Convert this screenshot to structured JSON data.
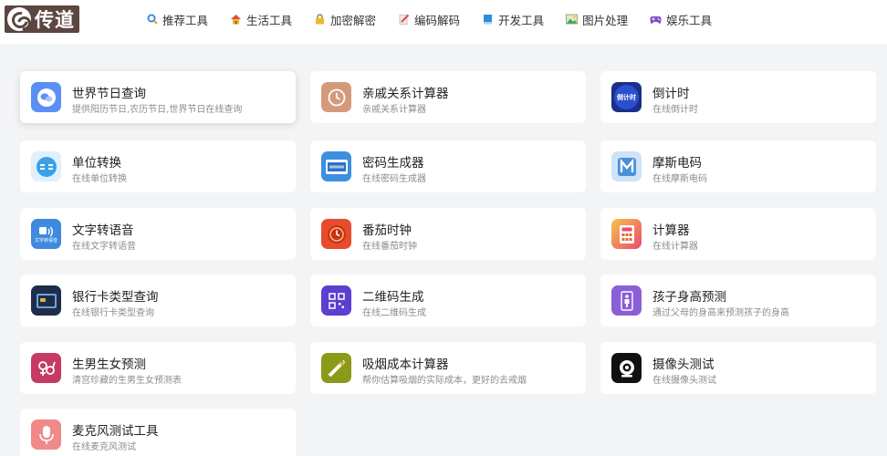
{
  "header": {
    "logo_text": "传道",
    "nav": [
      {
        "label": "推荐工具",
        "icon": "search-icon",
        "color": "#2f80ed"
      },
      {
        "label": "生活工具",
        "icon": "home-icon",
        "color": "#e06b2b"
      },
      {
        "label": "加密解密",
        "icon": "lock-icon",
        "color": "#e0a21e"
      },
      {
        "label": "编码解码",
        "icon": "edit-icon",
        "color": "#d94a6a"
      },
      {
        "label": "开发工具",
        "icon": "book-icon",
        "color": "#2f8ed9"
      },
      {
        "label": "图片处理",
        "icon": "image-icon",
        "color": "#3aa65a"
      },
      {
        "label": "娱乐工具",
        "icon": "gamepad-icon",
        "color": "#7d4fc9"
      }
    ]
  },
  "cards": [
    {
      "title": "世界节日查询",
      "desc": "提供阳历节日,农历节日,世界节日在线查询",
      "icon": "speech-bubble-icon",
      "color": "#5a8ff5"
    },
    {
      "title": "亲戚关系计算器",
      "desc": "亲戚关系计算器",
      "icon": "clock-icon",
      "color": "#d59a7c"
    },
    {
      "title": "倒计时",
      "desc": "在线倒计时",
      "icon": "countdown-icon",
      "icon_text": "倒计时",
      "color": "#1c2f8a"
    },
    {
      "title": "单位转换",
      "desc": "在线单位转换",
      "icon": "unit-convert-icon",
      "color": "#3aa0e8"
    },
    {
      "title": "密码生成器",
      "desc": "在线密码生成器",
      "icon": "password-icon",
      "color": "#3d8fe0"
    },
    {
      "title": "摩斯电码",
      "desc": "在线摩斯电码",
      "icon": "morse-icon",
      "color": "#4a8fd8"
    },
    {
      "title": "文字转语音",
      "desc": "在线文字转语音",
      "icon": "text-to-speech-icon",
      "icon_text": "文字转语音",
      "color": "#3f8ae0"
    },
    {
      "title": "番茄时钟",
      "desc": "在线番茄时钟",
      "icon": "tomato-clock-icon",
      "color": "#e84c2e"
    },
    {
      "title": "计算器",
      "desc": "在线计算器",
      "icon": "calculator-icon",
      "color": "#e94b6e"
    },
    {
      "title": "银行卡类型查询",
      "desc": "在线银行卡类型查询",
      "icon": "bank-card-icon",
      "color": "#1e2d4a"
    },
    {
      "title": "二维码生成",
      "desc": "在线二维码生成",
      "icon": "qrcode-icon",
      "color": "#5a3fd0"
    },
    {
      "title": "孩子身高预测",
      "desc": "通过父母的身高来预测孩子的身高",
      "icon": "height-icon",
      "color": "#8a5fd8"
    },
    {
      "title": "生男生女预测",
      "desc": "清宫珍藏的生男生女预测表",
      "icon": "gender-icon",
      "color": "#c73a66"
    },
    {
      "title": "吸烟成本计算器",
      "desc": "帮你估算吸烟的实际成本，更好的去戒烟",
      "icon": "cigarette-icon",
      "color": "#8a9a1a"
    },
    {
      "title": "摄像头测试",
      "desc": "在线摄像头测试",
      "icon": "camera-icon",
      "color": "#111111"
    },
    {
      "title": "麦克风测试工具",
      "desc": "在线麦克风测试",
      "icon": "microphone-icon",
      "color": "#f08a8a"
    }
  ]
}
